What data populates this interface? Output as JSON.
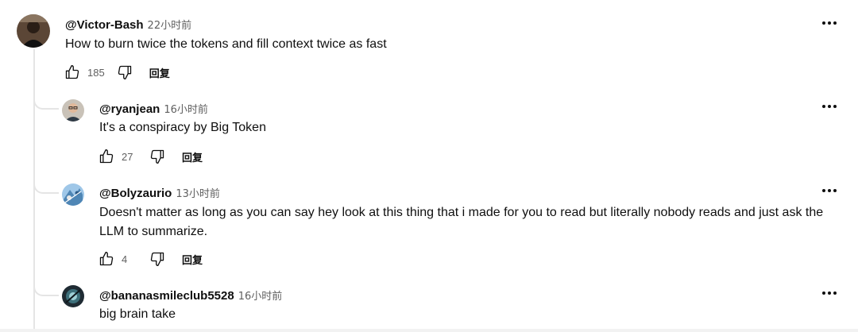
{
  "comments": [
    {
      "handle": "@Victor-Bash",
      "time": "22小时前",
      "text": "How to burn twice the tokens and fill context twice as fast",
      "likes": "185",
      "reply_label": "回复",
      "avatar_icon": "user-avatar-dark"
    },
    {
      "handle": "@ryanjean",
      "time": "16小时前",
      "text": "It's a conspiracy by Big Token",
      "likes": "27",
      "reply_label": "回复",
      "avatar_icon": "user-avatar-glasses"
    },
    {
      "handle": "@Bolyzaurio",
      "time": "13小时前",
      "text": "Doesn't matter as long as you can say hey look at this thing that i made for you to read but literally nobody reads and just ask the LLM to summarize.",
      "likes": "4",
      "reply_label": "回复",
      "avatar_icon": "user-avatar-blue-pattern"
    },
    {
      "handle": "@bananasmileclub5528",
      "time": "16小时前",
      "text": "big brain take",
      "avatar_icon": "user-avatar-teal"
    }
  ],
  "colors": {
    "text": "#0f0f0f",
    "meta": "#606060",
    "thread": "#e5e5e5"
  }
}
